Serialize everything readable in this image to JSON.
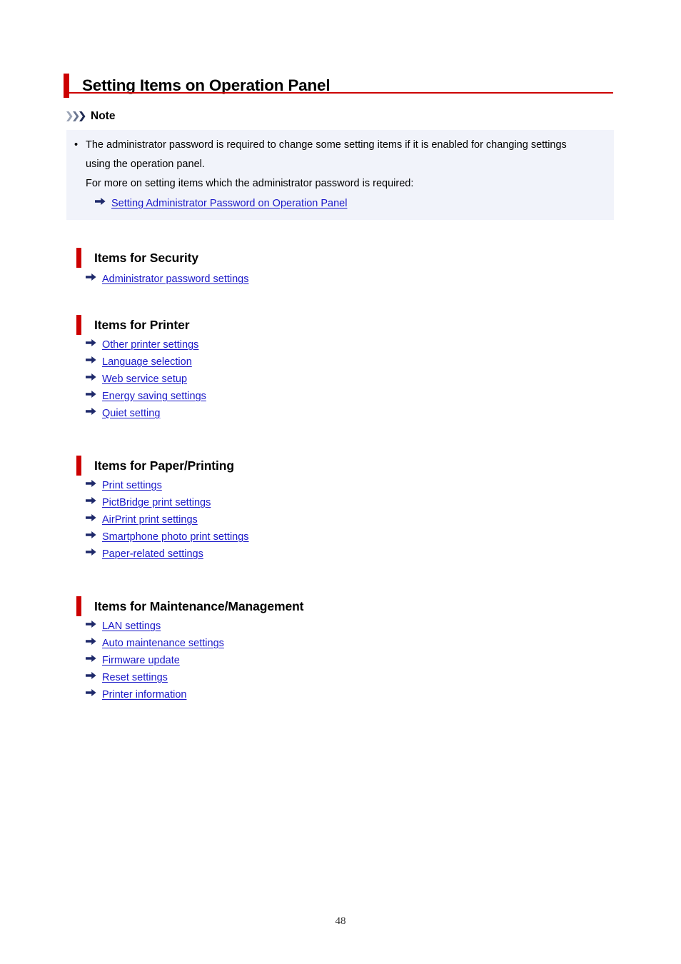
{
  "document": {
    "page_title": "Setting Items on Operation Panel",
    "page_number": "48",
    "accent_color": "#cc0000",
    "link_color": "#1a18c8",
    "note_background": "#f1f3fa"
  },
  "note": {
    "label": "Note",
    "icon": "triple-chevron-icon",
    "bullet_glyph": "•",
    "bullet_text": "The administrator password is required to change some setting items if it is enabled for changing settings using the operation panel.",
    "paragraph": "For more on setting items which the administrator password is required:",
    "link": {
      "label": "Setting Administrator Password on Operation Panel",
      "icon": "arrow-right-icon"
    }
  },
  "sections": [
    {
      "heading": "Items for Security",
      "links": [
        {
          "label": "Administrator password settings",
          "icon": "arrow-right-icon"
        }
      ]
    },
    {
      "heading": "Items for Printer",
      "links": [
        {
          "label": "Other printer settings",
          "icon": "arrow-right-icon"
        },
        {
          "label": "Language selection",
          "icon": "arrow-right-icon"
        },
        {
          "label": "Web service setup",
          "icon": "arrow-right-icon"
        },
        {
          "label": "Energy saving settings",
          "icon": "arrow-right-icon"
        },
        {
          "label": "Quiet setting",
          "icon": "arrow-right-icon"
        }
      ]
    },
    {
      "heading": "Items for Paper/Printing",
      "links": [
        {
          "label": "Print settings",
          "icon": "arrow-right-icon"
        },
        {
          "label": "PictBridge print settings",
          "icon": "arrow-right-icon"
        },
        {
          "label": "AirPrint print settings",
          "icon": "arrow-right-icon"
        },
        {
          "label": "Smartphone photo print settings",
          "icon": "arrow-right-icon"
        },
        {
          "label": "Paper-related settings",
          "icon": "arrow-right-icon"
        }
      ]
    },
    {
      "heading": "Items for Maintenance/Management",
      "links": [
        {
          "label": "LAN settings",
          "icon": "arrow-right-icon"
        },
        {
          "label": "Auto maintenance settings",
          "icon": "arrow-right-icon"
        },
        {
          "label": "Firmware update",
          "icon": "arrow-right-icon"
        },
        {
          "label": "Reset settings",
          "icon": "arrow-right-icon"
        },
        {
          "label": "Printer information",
          "icon": "arrow-right-icon"
        }
      ]
    }
  ]
}
